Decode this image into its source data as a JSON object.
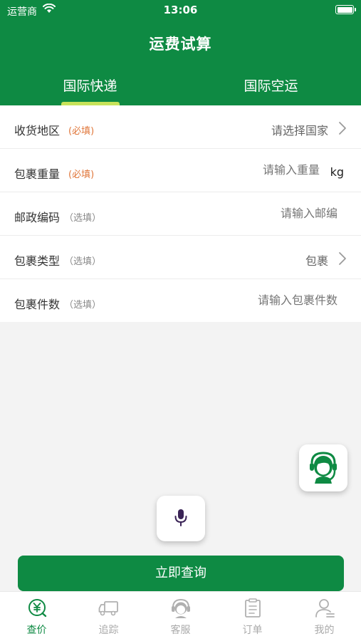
{
  "status_bar": {
    "carrier": "运营商",
    "time": "13:06"
  },
  "header": {
    "title": "运费试算",
    "tabs": [
      {
        "label": "国际快递",
        "active": true
      },
      {
        "label": "国际空运",
        "active": false
      }
    ]
  },
  "form": {
    "rows": [
      {
        "label": "收货地区",
        "tag": "(必填)",
        "value": "请选择国家",
        "has_chevron": true
      },
      {
        "label": "包裹重量",
        "tag": "(必填)",
        "placeholder": "请输入重量",
        "unit": "kg"
      },
      {
        "label": "邮政编码",
        "tag": "（选填）",
        "placeholder": "请输入邮编"
      },
      {
        "label": "包裹类型",
        "tag": "（选填）",
        "value": "包裹",
        "has_chevron": true
      },
      {
        "label": "包裹件数",
        "tag": "（选填）",
        "placeholder": "请输入包裹件数"
      }
    ]
  },
  "query_button": {
    "label": "立即查询"
  },
  "tabbar": {
    "items": [
      {
        "label": "查价",
        "icon": "price-icon",
        "active": true
      },
      {
        "label": "追踪",
        "icon": "truck-icon",
        "active": false
      },
      {
        "label": "客服",
        "icon": "headset-icon",
        "active": false
      },
      {
        "label": "订单",
        "icon": "order-icon",
        "active": false
      },
      {
        "label": "我的",
        "icon": "profile-icon",
        "active": false
      }
    ]
  },
  "colors": {
    "brand": "#0e8a43",
    "tab_indicator": "#c8e35a",
    "required": "#e0773b"
  }
}
